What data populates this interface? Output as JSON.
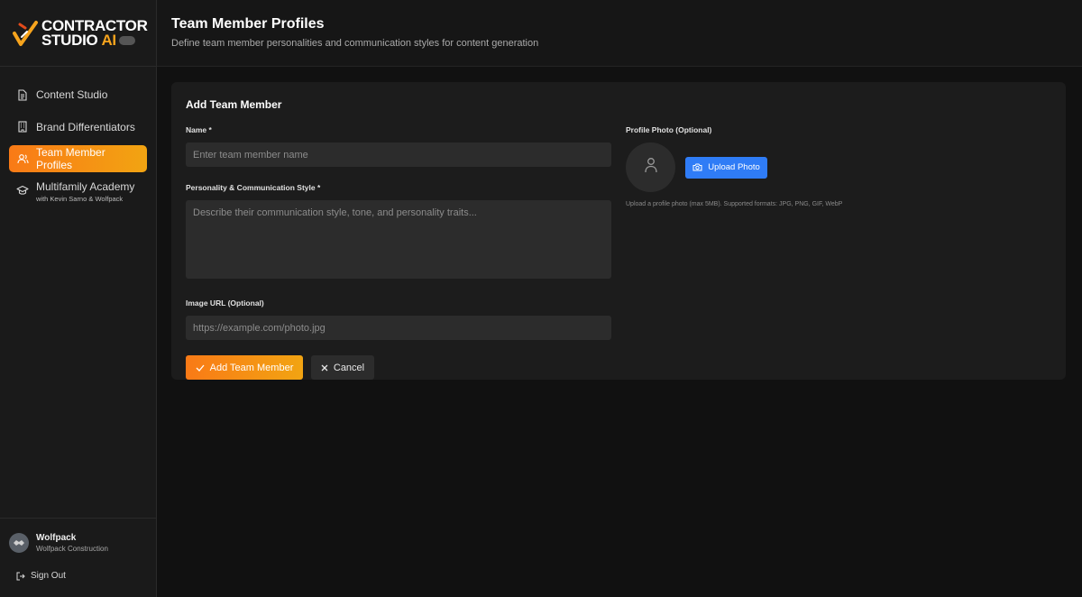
{
  "brand": {
    "line1": "CONTRACTOR",
    "line2": "STUDIO",
    "ai": "AI",
    "accent": "#f7a41d"
  },
  "sidebar": {
    "items": [
      {
        "label": "Content Studio",
        "icon": "document-icon",
        "active": false
      },
      {
        "label": "Brand Differentiators",
        "icon": "building-icon",
        "active": false
      },
      {
        "label": "Team Member Profiles",
        "icon": "users-icon",
        "active": true
      },
      {
        "label": "Multifamily Academy",
        "sublabel": "with Kevin Sarno & Wolfpack",
        "icon": "graduation-cap-icon",
        "active": false
      }
    ],
    "user": {
      "name": "Wolfpack",
      "company": "Wolfpack Construction"
    },
    "signout_label": "Sign Out"
  },
  "header": {
    "title": "Team Member Profiles",
    "subtitle": "Define team member personalities and communication styles for content generation"
  },
  "form": {
    "title": "Add Team Member",
    "name_label": "Name *",
    "name_placeholder": "Enter team member name",
    "name_value": "",
    "personality_label": "Personality & Communication Style *",
    "personality_placeholder": "Describe their communication style, tone, and personality traits...",
    "personality_value": "",
    "image_url_label": "Image URL (Optional)",
    "image_url_placeholder": "https://example.com/photo.jpg",
    "image_url_value": "",
    "submit_label": "Add Team Member",
    "cancel_label": "Cancel",
    "photo_label": "Profile Photo (Optional)",
    "upload_label": "Upload Photo",
    "photo_hint": "Upload a profile photo (max 5MB). Supported formats: JPG, PNG, GIF, WebP"
  },
  "colors": {
    "accent_start": "#f97a16",
    "accent_end": "#f2a412",
    "upload_blue": "#2f7cf6",
    "background": "#111111"
  }
}
